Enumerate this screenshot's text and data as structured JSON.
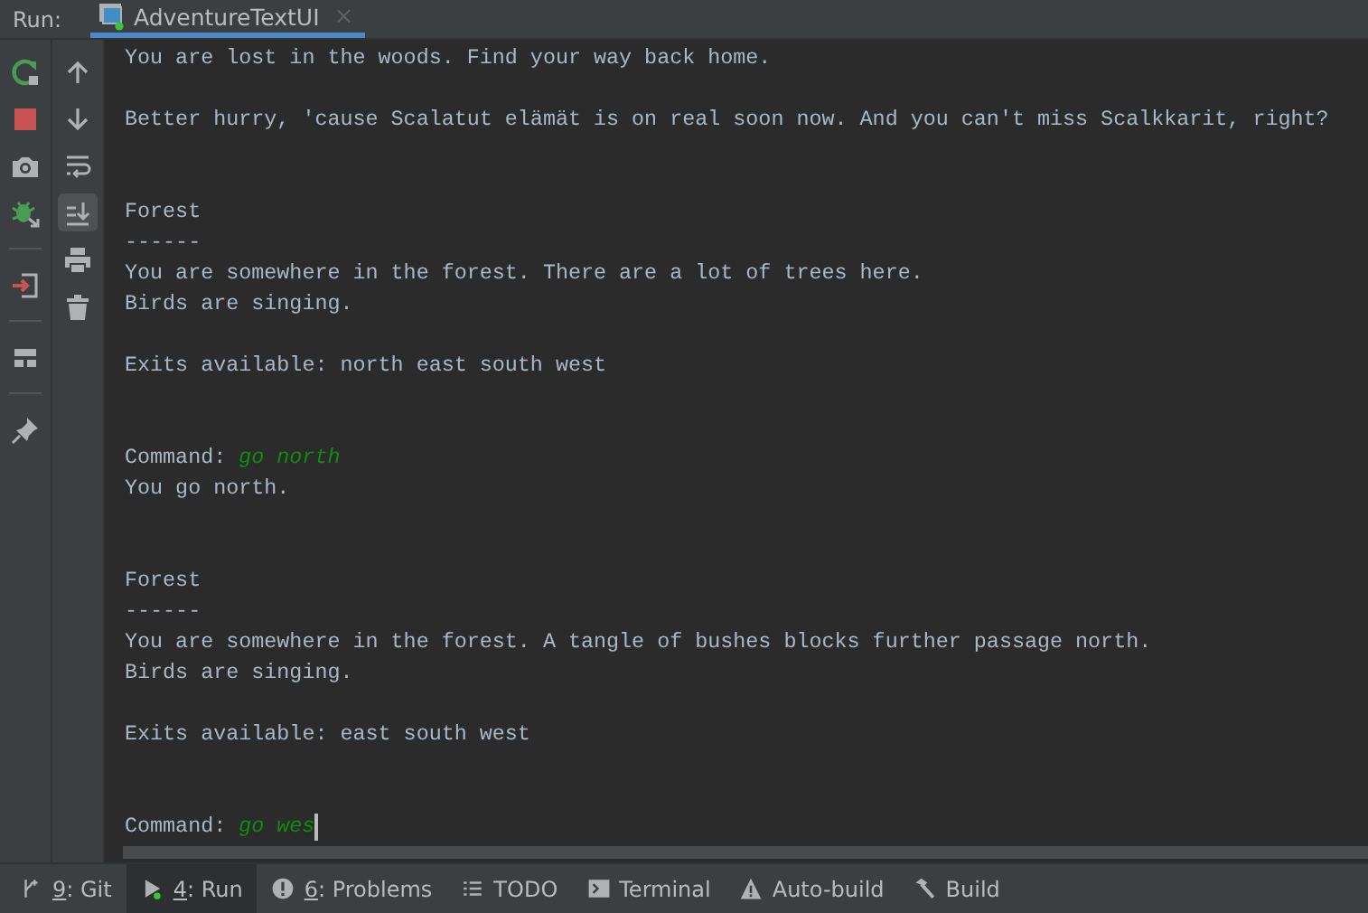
{
  "header": {
    "label": "Run:",
    "tabs": [
      {
        "title": "AdventureTextUI",
        "selected": true,
        "running": true,
        "close": "×"
      }
    ]
  },
  "toolbar_1": [
    {
      "kind": "rerun"
    },
    {
      "kind": "stop"
    },
    {
      "kind": "camera"
    },
    {
      "kind": "debug",
      "separator_after": true
    },
    {
      "kind": "exit",
      "separator_after": true
    },
    {
      "kind": "layout",
      "separator_after": true
    },
    {
      "kind": "pin"
    }
  ],
  "toolbar_2": [
    {
      "kind": "up",
      "selected": false
    },
    {
      "kind": "down",
      "selected": false
    },
    {
      "kind": "wrap",
      "selected": false
    },
    {
      "kind": "scrollend",
      "selected": true
    },
    {
      "kind": "print",
      "selected": false
    },
    {
      "kind": "trash",
      "selected": false
    }
  ],
  "console": [
    {
      "kind": "text",
      "text": "You are lost in the woods. Find your way back home."
    },
    {
      "kind": "blank"
    },
    {
      "kind": "text",
      "text": "Better hurry, 'cause Scalatut elämät is on real soon now. And you can't miss Scalkkarit, right?"
    },
    {
      "kind": "blank"
    },
    {
      "kind": "blank"
    },
    {
      "kind": "text",
      "text": "Forest"
    },
    {
      "kind": "text",
      "text": "------"
    },
    {
      "kind": "text",
      "text": "You are somewhere in the forest. There are a lot of trees here."
    },
    {
      "kind": "text",
      "text": "Birds are singing."
    },
    {
      "kind": "blank"
    },
    {
      "kind": "text",
      "text": "Exits available: north east south west"
    },
    {
      "kind": "blank"
    },
    {
      "kind": "blank"
    },
    {
      "kind": "command",
      "prompt": "Command:",
      "input": "go north"
    },
    {
      "kind": "text",
      "text": "You go north."
    },
    {
      "kind": "blank"
    },
    {
      "kind": "blank"
    },
    {
      "kind": "text",
      "text": "Forest"
    },
    {
      "kind": "text",
      "text": "------"
    },
    {
      "kind": "text",
      "text": "You are somewhere in the forest. A tangle of bushes blocks further passage north."
    },
    {
      "kind": "text",
      "text": "Birds are singing."
    },
    {
      "kind": "blank"
    },
    {
      "kind": "text",
      "text": "Exits available: east south west"
    },
    {
      "kind": "blank"
    },
    {
      "kind": "blank"
    },
    {
      "kind": "command",
      "prompt": "Command:",
      "input": "go wes",
      "cursor": true
    }
  ],
  "tool_windows": [
    {
      "kind": "git",
      "mnemonic": "9",
      "label": ": Git",
      "selected": false
    },
    {
      "kind": "run",
      "mnemonic": "4",
      "label": ": Run",
      "selected": true
    },
    {
      "kind": "problems",
      "mnemonic": "6",
      "label": ": Problems",
      "selected": false
    },
    {
      "kind": "todo",
      "label": "TODO",
      "selected": false
    },
    {
      "kind": "terminal",
      "label": "Terminal",
      "selected": false
    },
    {
      "kind": "warning",
      "label": "Auto-build",
      "selected": false
    },
    {
      "kind": "hammer",
      "label": "Build",
      "selected": false
    }
  ]
}
